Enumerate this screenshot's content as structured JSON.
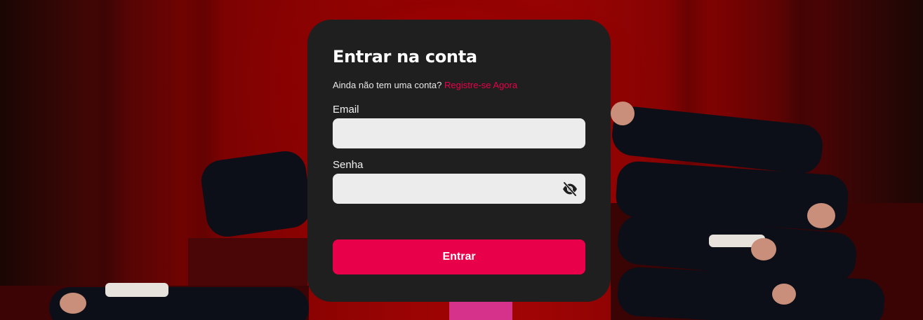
{
  "login": {
    "title": "Entrar na conta",
    "subtitle_text": "Ainda não tem uma conta?",
    "register_link": "Registre-se Agora",
    "email_label": "Email",
    "email_value": "",
    "password_label": "Senha",
    "password_value": "",
    "submit_label": "Entrar",
    "password_toggle_icon": "eye-off-icon"
  },
  "theme": {
    "card_background": "#1f1f1f",
    "accent": "#e8004a",
    "input_background": "#ececec",
    "backdrop_red": "#a00404"
  }
}
